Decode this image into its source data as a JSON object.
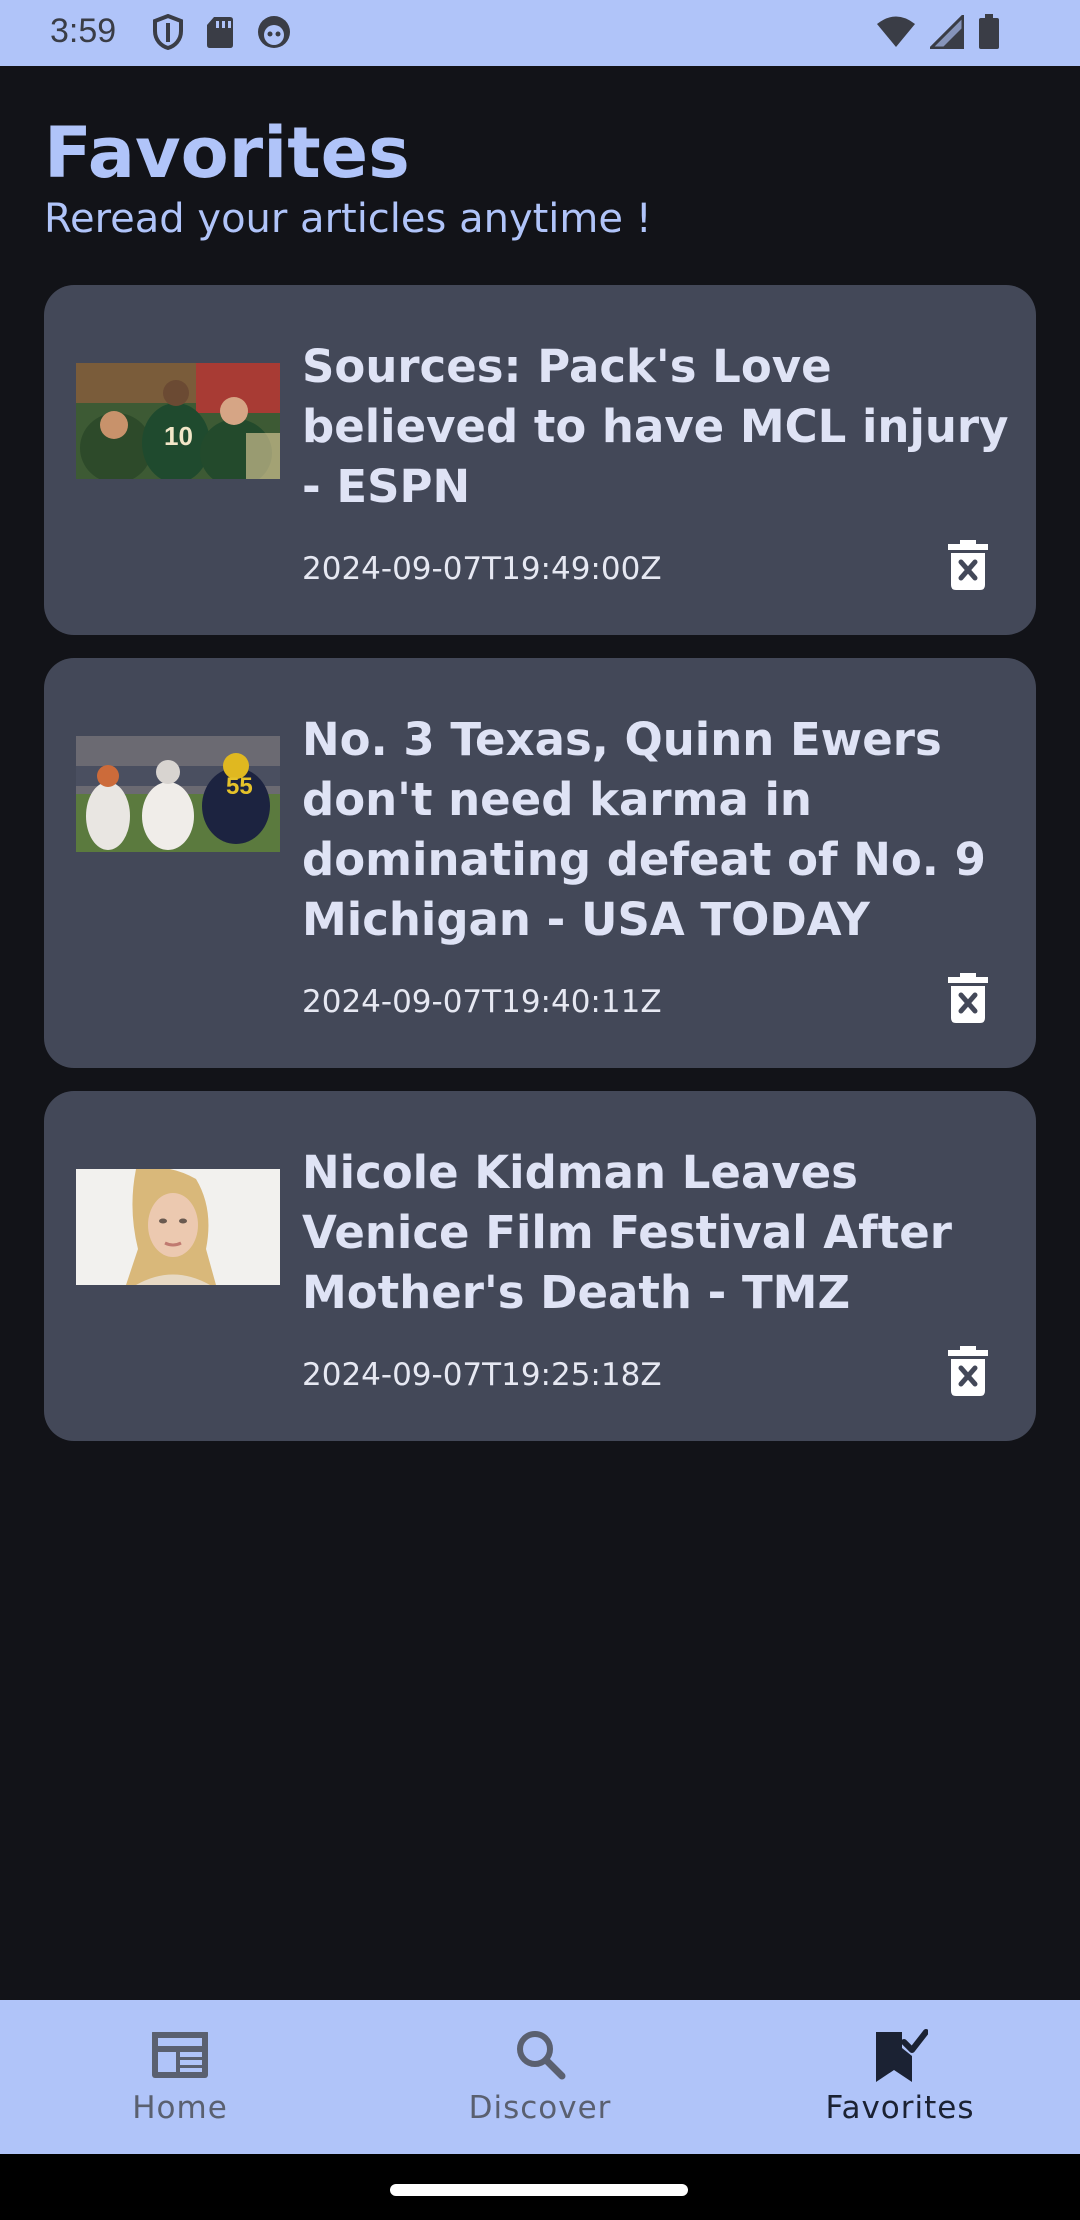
{
  "status_bar": {
    "time": "3:59",
    "left_icons": [
      "shield-icon",
      "sd-card-icon",
      "face-icon"
    ],
    "right_icons": [
      "wifi-icon",
      "signal-icon",
      "battery-icon"
    ]
  },
  "header": {
    "title": "Favorites",
    "subtitle": "Reread your articles anytime !"
  },
  "articles": [
    {
      "title": "Sources: Pack's Love believed to have MCL injury - ESPN",
      "published": "2024-09-07T19:49:00Z",
      "delete_icon": "delete-icon"
    },
    {
      "title": "No. 3 Texas, Quinn Ewers don't need karma in dominating defeat of No. 9 Michigan - USA TODAY",
      "published": "2024-09-07T19:40:11Z",
      "delete_icon": "delete-icon"
    },
    {
      "title": "Nicole Kidman Leaves Venice Film Festival After Mother's Death - TMZ",
      "published": "2024-09-07T19:25:18Z",
      "delete_icon": "delete-icon"
    }
  ],
  "bottom_nav": {
    "items": [
      {
        "label": "Home",
        "icon": "newspaper-icon"
      },
      {
        "label": "Discover",
        "icon": "search-icon"
      },
      {
        "label": "Favorites",
        "icon": "bookmark-check-icon",
        "active": true
      }
    ]
  },
  "colors": {
    "accent": "#b0c4f9",
    "background": "#121318",
    "card": "#434858"
  }
}
